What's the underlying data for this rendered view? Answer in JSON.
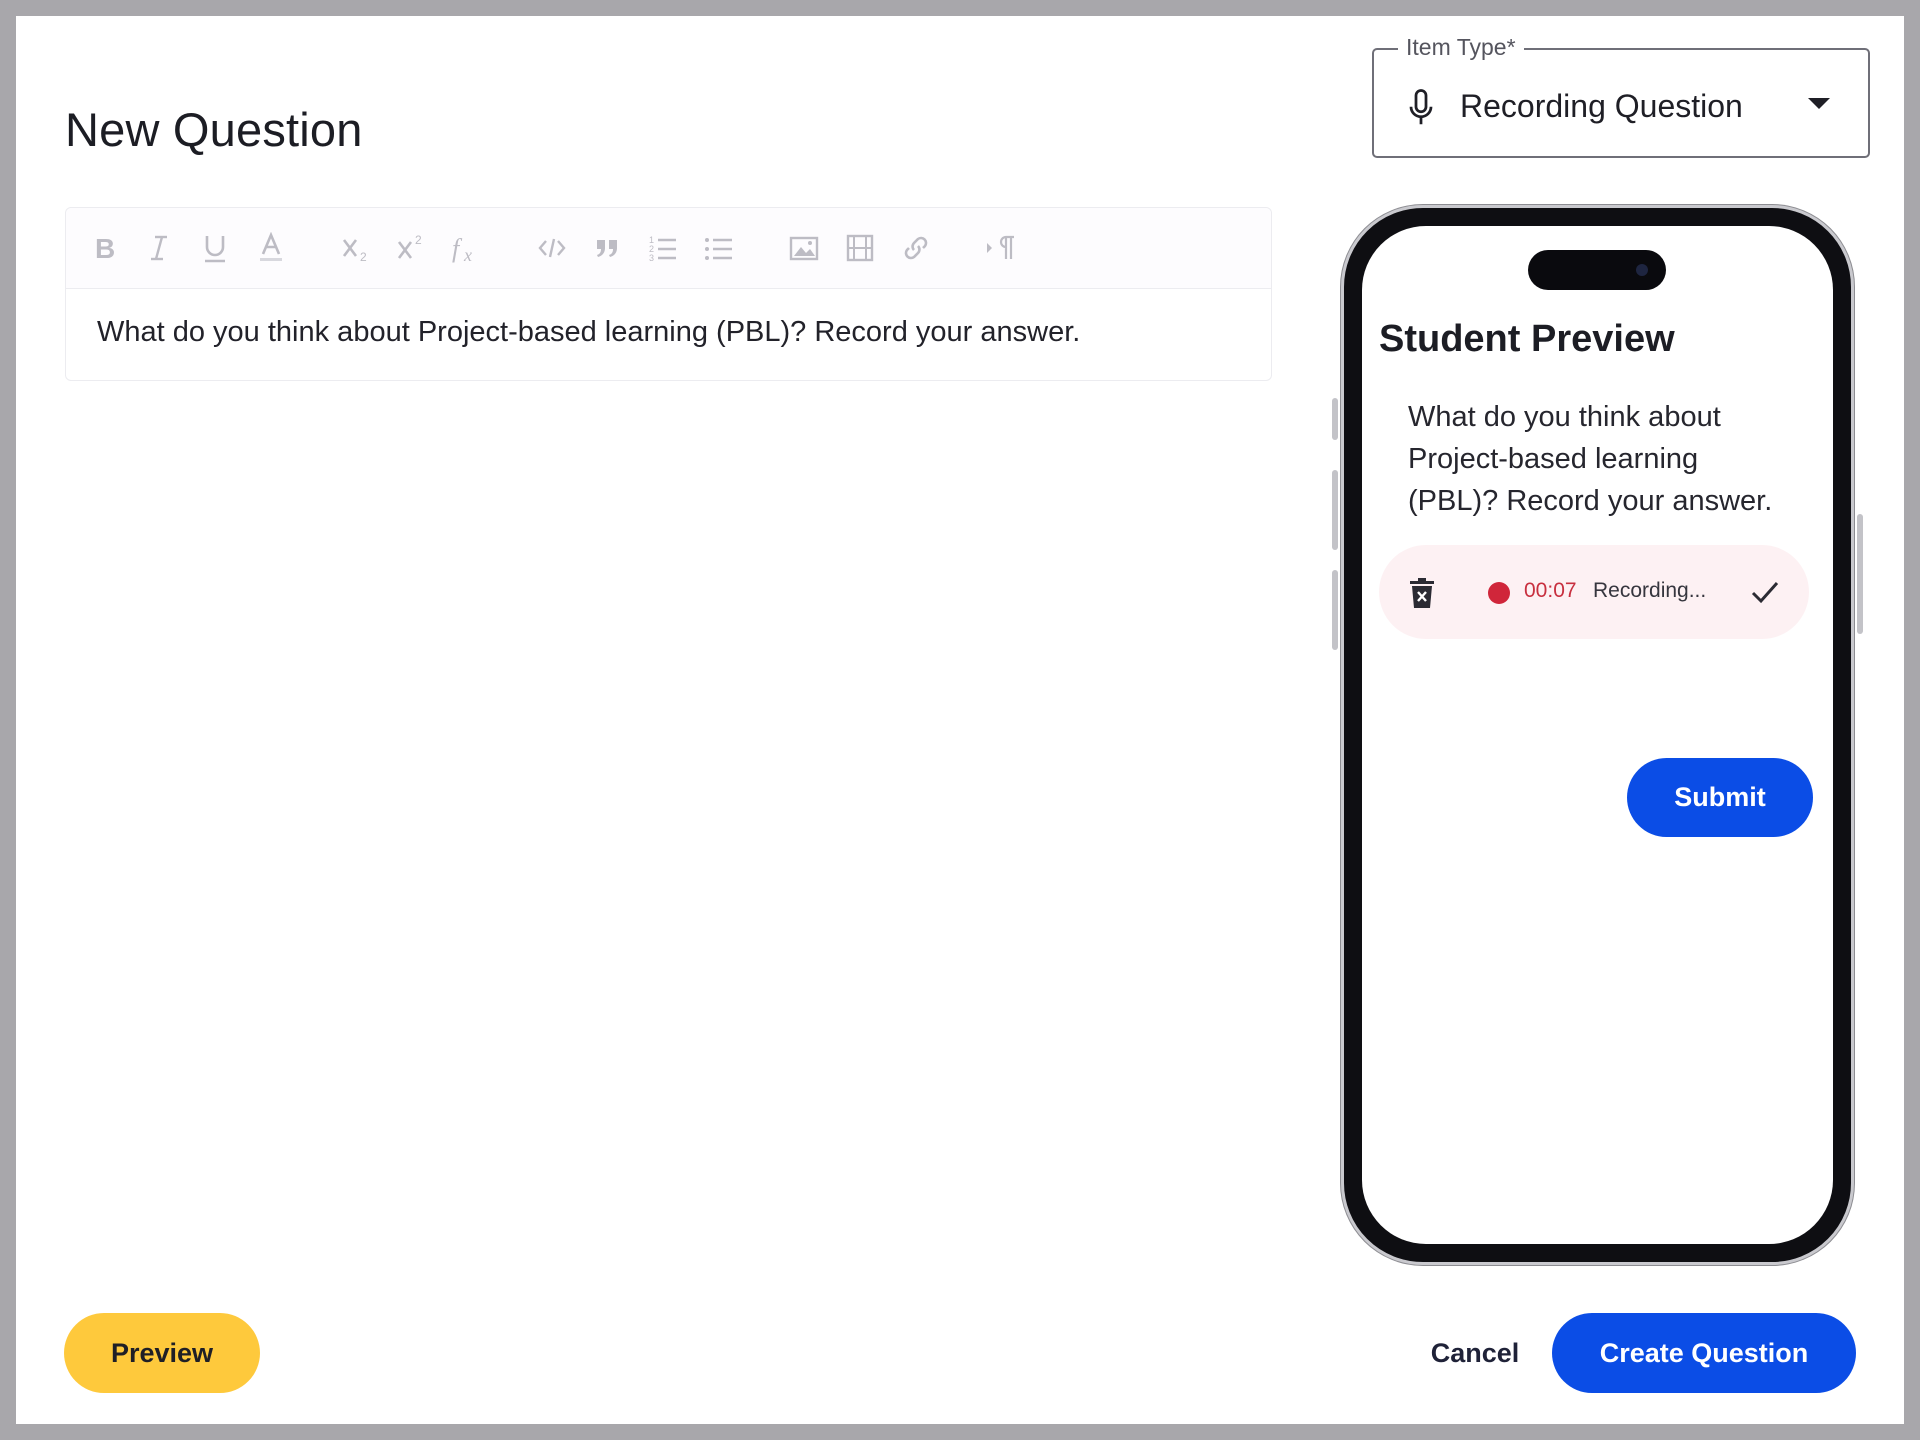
{
  "page": {
    "title": "New Question"
  },
  "item_type": {
    "legend": "Item Type*",
    "value": "Recording Question",
    "icon": "microphone-icon"
  },
  "editor": {
    "toolbar": [
      {
        "name": "bold",
        "icon": "bold-icon"
      },
      {
        "name": "italic",
        "icon": "italic-icon"
      },
      {
        "name": "underline",
        "icon": "underline-icon"
      },
      {
        "name": "text-color",
        "icon": "text-color-icon"
      },
      {
        "name": "subscript",
        "icon": "subscript-icon"
      },
      {
        "name": "superscript",
        "icon": "superscript-icon"
      },
      {
        "name": "formula",
        "icon": "formula-icon"
      },
      {
        "name": "code",
        "icon": "code-icon"
      },
      {
        "name": "blockquote",
        "icon": "quote-icon"
      },
      {
        "name": "ordered-list",
        "icon": "ordered-list-icon"
      },
      {
        "name": "bullet-list",
        "icon": "bullet-list-icon"
      },
      {
        "name": "image",
        "icon": "image-icon"
      },
      {
        "name": "video",
        "icon": "video-icon"
      },
      {
        "name": "link",
        "icon": "link-icon"
      },
      {
        "name": "text-direction",
        "icon": "text-direction-icon"
      }
    ],
    "content": "What do you think about Project-based learning (PBL)? Record your answer."
  },
  "student_preview": {
    "title": "Student Preview",
    "question": "What do you think about Project-based learning (PBL)? Record your answer.",
    "recorder": {
      "time": "00:07",
      "status": "Recording...",
      "dot_color": "#d0263a"
    },
    "submit_label": "Submit"
  },
  "footer": {
    "preview_label": "Preview",
    "cancel_label": "Cancel",
    "create_label": "Create Question"
  },
  "colors": {
    "primary": "#0b4de6",
    "accent_yellow": "#fec93c",
    "recording_red": "#d0263a"
  }
}
